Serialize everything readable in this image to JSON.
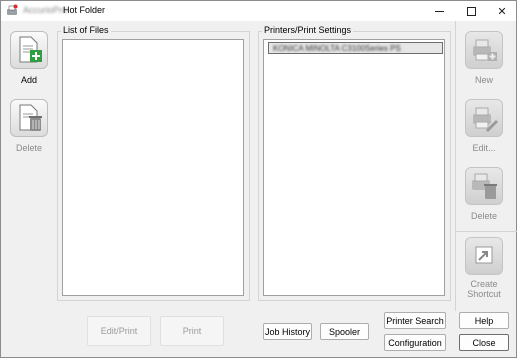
{
  "titlebar": {
    "app_name": "AccurioPro",
    "title": "Hot Folder",
    "minimize": "—",
    "maximize": "□",
    "close": "✕"
  },
  "left_tools": {
    "add": "Add",
    "delete": "Delete"
  },
  "files_panel": {
    "label": "List of Files"
  },
  "printers_panel": {
    "label": "Printers/Print Settings",
    "items": [
      "KONICA MINOLTA C3100Series PS"
    ]
  },
  "right_tools": {
    "new": "New",
    "edit": "Edit...",
    "delete": "Delete",
    "create_shortcut_line1": "Create",
    "create_shortcut_line2": "Shortcut"
  },
  "bottom": {
    "edit_print": "Edit/Print",
    "print": "Print",
    "job_history": "Job History",
    "spooler": "Spooler",
    "printer_search": "Printer Search",
    "configuration": "Configuration",
    "help": "Help",
    "close": "Close"
  },
  "colors": {
    "accent_green": "#2e9e3e",
    "window_bg": "#f0f0f0"
  }
}
